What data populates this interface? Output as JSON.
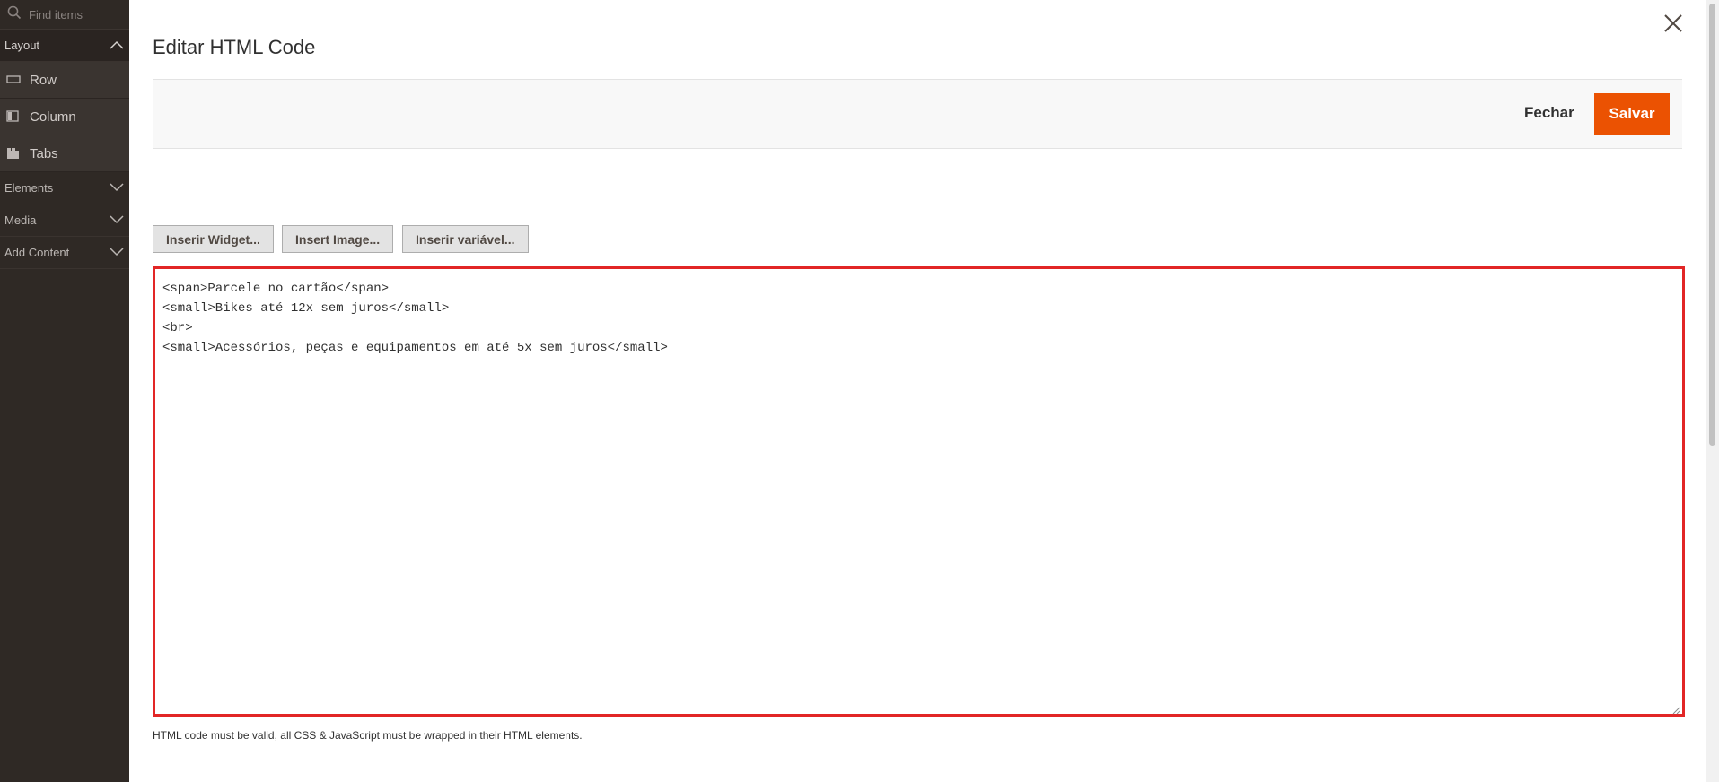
{
  "sidebar": {
    "search_placeholder": "Find items",
    "groups": [
      {
        "label": "Layout",
        "state": "expanded"
      },
      {
        "label": "Elements",
        "state": "collapsed"
      },
      {
        "label": "Media",
        "state": "collapsed"
      },
      {
        "label": "Add Content",
        "state": "collapsed"
      }
    ],
    "layout_items": [
      {
        "label": "Row",
        "icon": "row-icon"
      },
      {
        "label": "Column",
        "icon": "column-icon"
      },
      {
        "label": "Tabs",
        "icon": "tabs-icon"
      }
    ]
  },
  "modal": {
    "title": "Editar HTML Code",
    "close_icon": "close-icon",
    "actions": {
      "close_label": "Fechar",
      "save_label": "Salvar"
    },
    "toolbar": {
      "widget_label": "Inserir Widget...",
      "image_label": "Insert Image...",
      "variable_label": "Inserir variável..."
    },
    "editor": {
      "content": "<span>Parcele no cartão</span>\n<small>Bikes até 12x sem juros</small>\n<br>\n<small>Acessórios, peças e equipamentos em até 5x sem juros</small>"
    },
    "note": "HTML code must be valid, all CSS & JavaScript must be wrapped in their HTML elements."
  },
  "colors": {
    "sidebar_bg": "#2f2925",
    "save_button": "#eb5202",
    "editor_border": "#e22626"
  }
}
